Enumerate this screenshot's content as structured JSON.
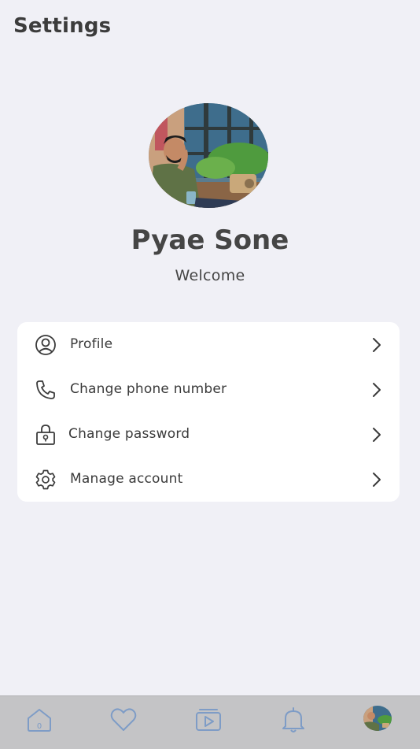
{
  "header": {
    "title": "Settings"
  },
  "profile": {
    "name": "Pyae Sone",
    "subtitle": "Welcome",
    "avatar": "user-illustration"
  },
  "menu": {
    "items": [
      {
        "label": "Profile",
        "icon": "user-circle-icon"
      },
      {
        "label": "Change phone number",
        "icon": "phone-icon"
      },
      {
        "label": "Change password",
        "icon": "lock-icon"
      },
      {
        "label": "Manage account",
        "icon": "gear-icon"
      }
    ]
  },
  "bottom_nav": {
    "items": [
      {
        "name": "home",
        "icon": "home-icon",
        "badge": "0"
      },
      {
        "name": "favorites",
        "icon": "heart-icon"
      },
      {
        "name": "videos",
        "icon": "video-play-icon"
      },
      {
        "name": "notifications",
        "icon": "bell-icon"
      },
      {
        "name": "account",
        "icon": "avatar"
      }
    ]
  },
  "colors": {
    "background": "#f0f0f6",
    "card": "#ffffff",
    "nav_background": "#c4c4c6",
    "nav_icon": "#7e9cc6",
    "text_primary": "#3c3c3c"
  }
}
